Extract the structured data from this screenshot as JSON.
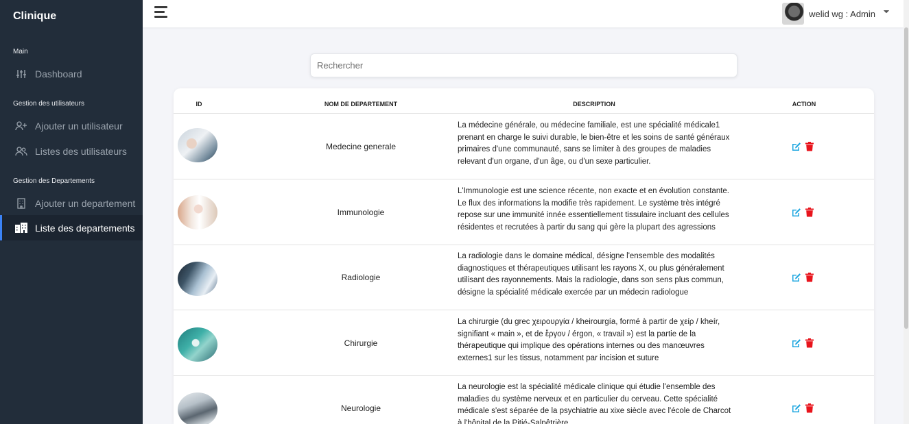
{
  "app": {
    "brand": "Clinique"
  },
  "sidebar": {
    "sections": [
      {
        "title": "Main",
        "items": [
          {
            "label": "Dashboard",
            "icon": "sliders-icon"
          }
        ]
      },
      {
        "title": "Gestion des utilisateurs",
        "items": [
          {
            "label": "Ajouter un utilisateur",
            "icon": "user-plus-icon"
          },
          {
            "label": "Listes des utilisateurs",
            "icon": "users-icon"
          }
        ]
      },
      {
        "title": "Gestion des Departements",
        "items": [
          {
            "label": "Ajouter un departement",
            "icon": "building-icon"
          },
          {
            "label": "Liste des departements",
            "icon": "buildings-icon",
            "active": true
          }
        ]
      }
    ]
  },
  "topbar": {
    "user": "welid wg : Admin"
  },
  "search": {
    "placeholder": "Rechercher",
    "value": ""
  },
  "table": {
    "columns": [
      "ID",
      "NOM DE DEPARTEMENT",
      "DESCRIPTION",
      "ACTION"
    ],
    "rows": [
      {
        "name": "Medecine generale",
        "description": "La médecine générale, ou médecine familiale, est une spécialité médicale1 prenant en charge le suivi durable, le bien-être et les soins de santé généraux primaires d'une communauté, sans se limiter à des groupes de maladies relevant d'un organe, d'un âge, ou d'un sexe particulier."
      },
      {
        "name": "Immunologie",
        "description": "L'Immunologie est une science récente, non exacte et en évolution constante. Le flux des informations la modifie très rapidement. Le système très intégré repose sur une immunité innée essentiellement tissulaire incluant des cellules résidentes et recrutées à partir du sang qui gère la plupart des agressions"
      },
      {
        "name": "Radiologie",
        "description": "La radiologie dans le domaine médical, désigne l'ensemble des modalités diagnostiques et thérapeutiques utilisant les rayons X, ou plus généralement utilisant des rayonnements. Mais la radiologie, dans son sens plus commun, désigne la spécialité médicale exercée par un médecin radiologue"
      },
      {
        "name": "Chirurgie",
        "description": "La chirurgie (du grec χειρουργία / kheirourgía, formé à partir de χείρ / kheír, signifiant « main », et de ἔργον / érgon, « travail ») est la partie de la thérapeutique qui implique des opérations internes ou des manœuvres externes1 sur les tissus, notamment par incision et suture"
      },
      {
        "name": "Neurologie",
        "description": "La neurologie est la spécialité médicale clinique qui étudie l'ensemble des maladies du système nerveux et en particulier du cerveau. Cette spécialité médicale s'est séparée de la psychiatrie au xixe siècle avec l'école de Charcot à l'hôpital de la Pitié-Salpêtrière."
      }
    ]
  },
  "colors": {
    "sidebar": "#222d3a",
    "edit": "#1fa7e0",
    "delete": "#e8141c",
    "active_border": "#3b82f6"
  }
}
